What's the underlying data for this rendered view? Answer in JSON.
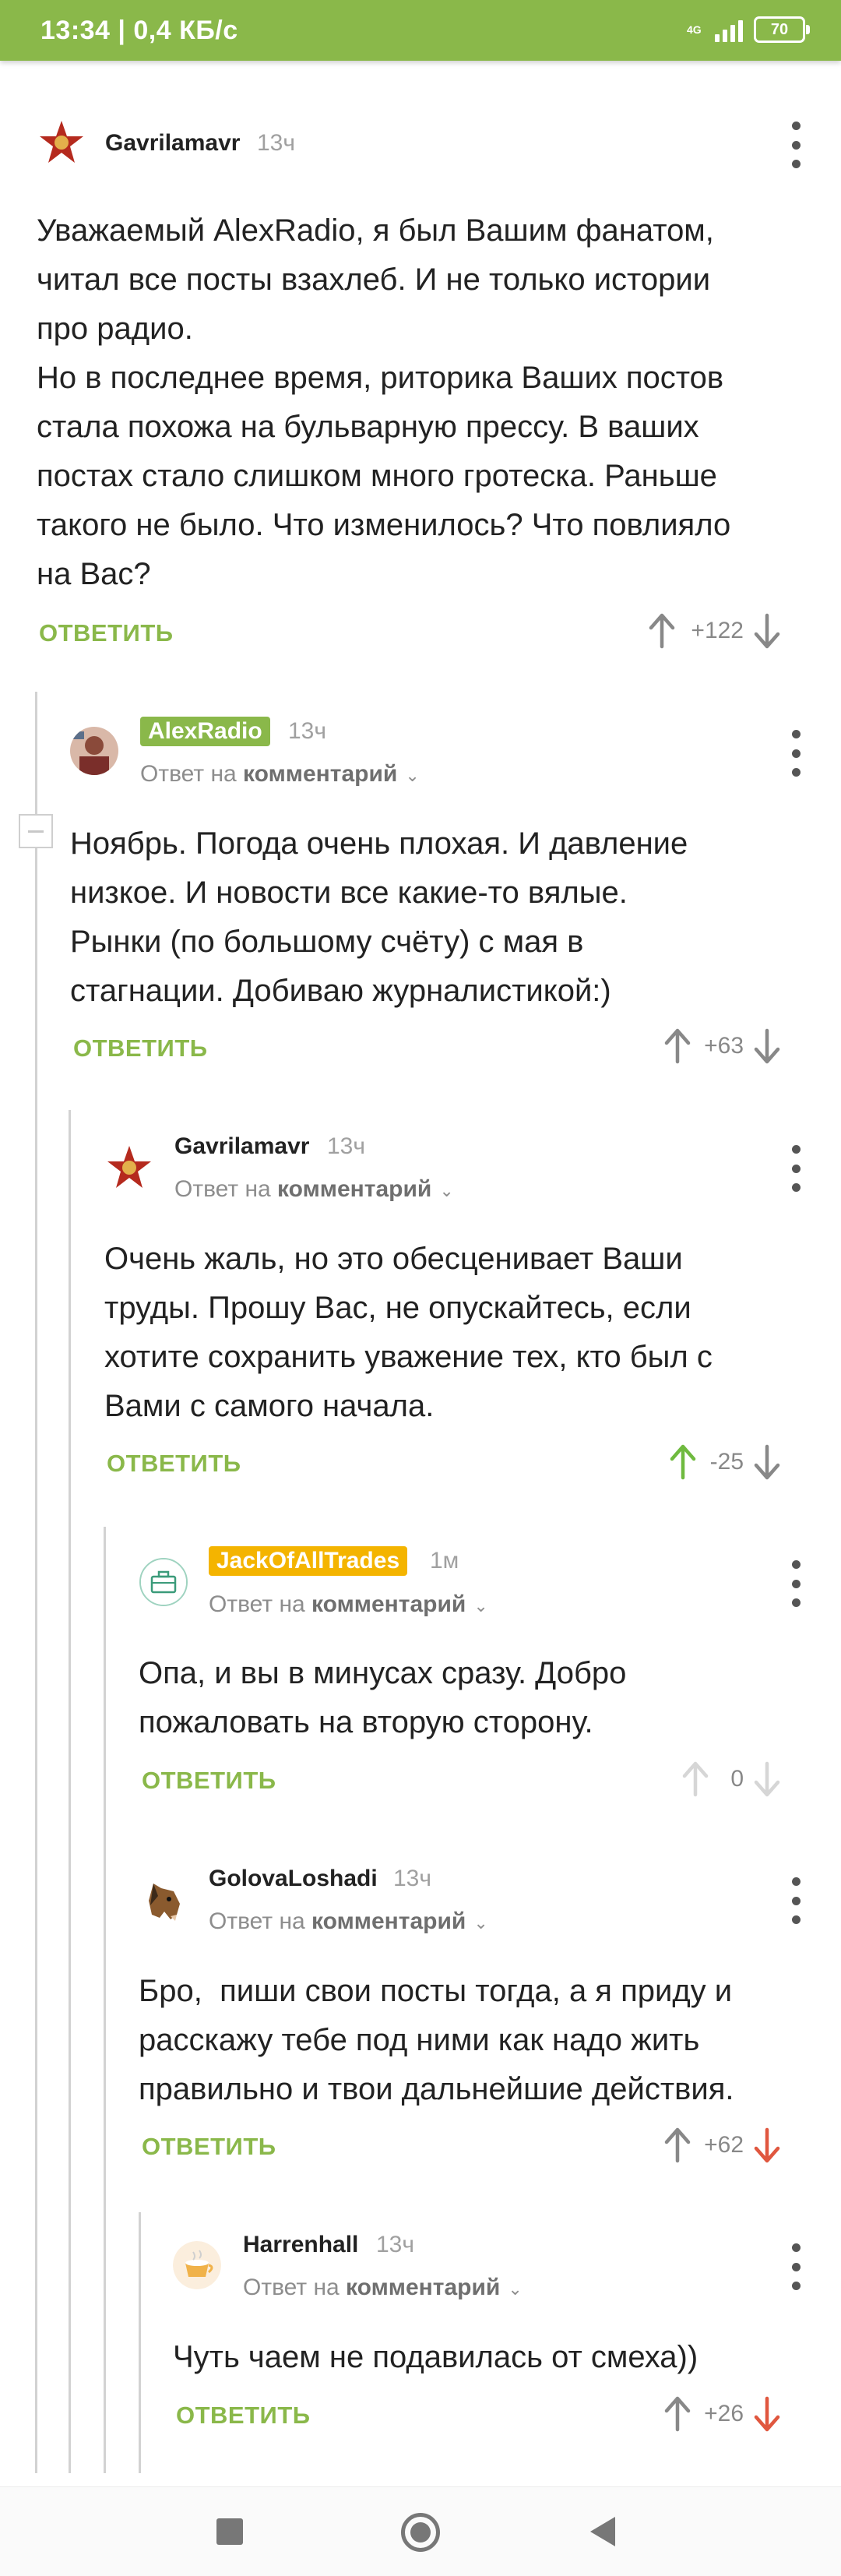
{
  "status_bar": {
    "time_speed": "13:34 | 0,4 КБ/с",
    "network": "4G",
    "battery": "70"
  },
  "colors": {
    "accent": "#8ab84a",
    "downvote_active": "#e0573f",
    "upvote_active": "#6fba3f",
    "alexradio_tag": "#8ab84a",
    "jack_tag": "#f4b400"
  },
  "comments": [
    {
      "author": "Gavrilamavr",
      "time": "13ч",
      "reply_prefix": "",
      "reply_target": "",
      "text": "Уважаемый AlexRadio, я был Вашим фанатом,\nчитал все посты взахлеб. И не только истории\nпро радио.\nНо в последнее время, риторика Ваших постов\nстала похожа на бульварную прессу. В ваших\nпостах стало слишком много гротеска. Раньше\nтакого не было. Что изменилось? Что повлияло\nна Вас?",
      "reply_label": "ОТВЕТИТЬ",
      "score": "+122",
      "avatar_icon": "red-star-avatar-icon"
    },
    {
      "author": "AlexRadio",
      "time": "13ч",
      "reply_prefix": "Ответ на",
      "reply_target": "комментарий",
      "text": "Ноябрь. Погода очень плохая. И давление\nнизкое. И новости все какие-то вялые.\nРынки (по большому счёту) с мая в\nстагнации. Добиваю журналистикой:)",
      "reply_label": "ОТВЕТИТЬ",
      "score": "+63",
      "avatar_icon": "photo-avatar-icon"
    },
    {
      "author": "Gavrilamavr",
      "time": "13ч",
      "reply_prefix": "Ответ на",
      "reply_target": "комментарий",
      "text": "Очень жаль, но это обесценивает Ваши\nтруды. Прошу Вас, не опускайтесь, если\nхотите сохранить уважение тех, кто был с\nВами с самого начала.",
      "reply_label": "ОТВЕТИТЬ",
      "score": "-25",
      "avatar_icon": "red-star-avatar-icon"
    },
    {
      "author": "JackOfAllTrades",
      "time": "1м",
      "reply_prefix": "Ответ на",
      "reply_target": "комментарий",
      "text": "Опа, и вы в минусах сразу. Добро\nпожаловать на вторую сторону.",
      "reply_label": "ОТВЕТИТЬ",
      "score": "0",
      "avatar_icon": "suitcase-avatar-icon"
    },
    {
      "author": "GolovaLoshadi",
      "time": "13ч",
      "reply_prefix": "Ответ на",
      "reply_target": "комментарий",
      "text": "Бро,  пиши свои посты тогда, а я приду и\nрасскажу тебе под ними как надо жить\nправильно и твои дальнейшие действия.",
      "reply_label": "ОТВЕТИТЬ",
      "score": "+62",
      "avatar_icon": "horse-head-avatar-icon"
    },
    {
      "author": "Harrenhall",
      "time": "13ч",
      "reply_prefix": "Ответ на",
      "reply_target": "комментарий",
      "text": "Чуть чаем не подавилась от смеха))",
      "reply_label": "ОТВЕТИТЬ",
      "score": "+26",
      "avatar_icon": "tea-cup-avatar-icon"
    }
  ]
}
